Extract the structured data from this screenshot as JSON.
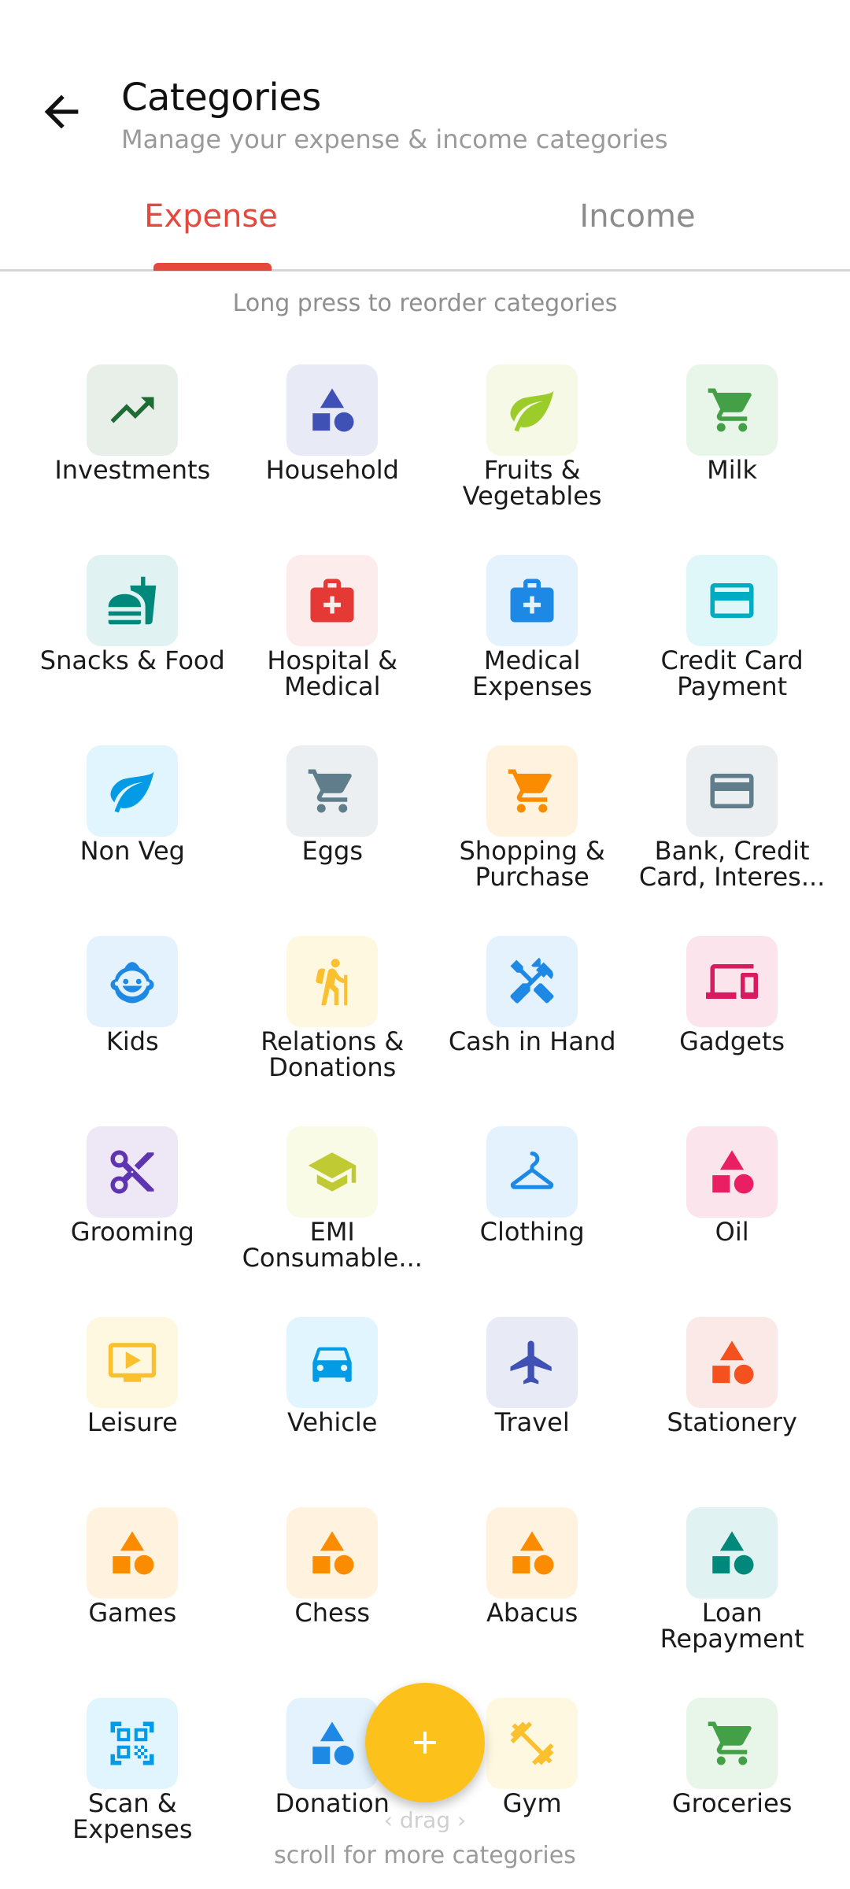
{
  "header": {
    "title": "Categories",
    "subtitle": "Manage your expense & income categories"
  },
  "tabs": [
    {
      "label": "Expense",
      "active": true
    },
    {
      "label": "Income",
      "active": false
    }
  ],
  "hint": "Long press to reorder categories",
  "categories": [
    {
      "label": "Investments",
      "icon": "trending-up-icon",
      "color": "#1e6b34",
      "bg": "#e8efe9"
    },
    {
      "label": "Household",
      "icon": "shapes-icon",
      "color": "#3f51b5",
      "bg": "#e8eaf6"
    },
    {
      "label": "Fruits & Vegetables",
      "icon": "leaf-icon",
      "color": "#9ccc2a",
      "bg": "#f5f9e6"
    },
    {
      "label": "Milk",
      "icon": "cart-icon",
      "color": "#43a047",
      "bg": "#e8f5e9"
    },
    {
      "label": "Snacks & Food",
      "icon": "fastfood-icon",
      "color": "#00897b",
      "bg": "#e0f2f1"
    },
    {
      "label": "Hospital & Medical",
      "icon": "medical-bag-icon",
      "color": "#e53935",
      "bg": "#fdecec"
    },
    {
      "label": "Medical Expenses",
      "icon": "medical-bag-icon",
      "color": "#1e88e5",
      "bg": "#e3f2fd"
    },
    {
      "label": "Credit Card Payment",
      "icon": "credit-card-icon",
      "color": "#00acc1",
      "bg": "#e0f7fa"
    },
    {
      "label": "Non Veg",
      "icon": "leaf-icon",
      "color": "#039be5",
      "bg": "#e1f5fe"
    },
    {
      "label": "Eggs",
      "icon": "cart-icon",
      "color": "#607d8b",
      "bg": "#eceff1"
    },
    {
      "label": "Shopping & Purchase",
      "icon": "cart-icon",
      "color": "#fb8c00",
      "bg": "#fff3e0"
    },
    {
      "label": "Bank, Credit Card, Interes...",
      "icon": "credit-card-icon",
      "color": "#607d8b",
      "bg": "#eceff1"
    },
    {
      "label": "Kids",
      "icon": "child-face-icon",
      "color": "#1e88e5",
      "bg": "#e3f2fd"
    },
    {
      "label": "Relations & Donations",
      "icon": "elderly-icon",
      "color": "#fbc02d",
      "bg": "#fff8e1"
    },
    {
      "label": "Cash in Hand",
      "icon": "tools-icon",
      "color": "#1e88e5",
      "bg": "#e3f2fd"
    },
    {
      "label": "Gadgets",
      "icon": "devices-icon",
      "color": "#d81b60",
      "bg": "#fce4ec"
    },
    {
      "label": "Grooming",
      "icon": "scissors-icon",
      "color": "#5e35b1",
      "bg": "#ede7f6"
    },
    {
      "label": "EMI Consumable...",
      "icon": "school-icon",
      "color": "#c0ca33",
      "bg": "#f9fbe7"
    },
    {
      "label": "Clothing",
      "icon": "hanger-icon",
      "color": "#1e88e5",
      "bg": "#e3f2fd"
    },
    {
      "label": "Oil",
      "icon": "shapes-icon",
      "color": "#e91e63",
      "bg": "#fce4ec"
    },
    {
      "label": "Leisure",
      "icon": "tv-icon",
      "color": "#fbc02d",
      "bg": "#fff8e1"
    },
    {
      "label": "Vehicle",
      "icon": "car-icon",
      "color": "#039be5",
      "bg": "#e1f5fe"
    },
    {
      "label": "Travel",
      "icon": "airplane-icon",
      "color": "#3f51b5",
      "bg": "#e8eaf6"
    },
    {
      "label": "Stationery",
      "icon": "shapes-icon",
      "color": "#f4511e",
      "bg": "#fbe9e7"
    },
    {
      "label": "Games",
      "icon": "shapes-icon",
      "color": "#fb8c00",
      "bg": "#fff3e0"
    },
    {
      "label": "Chess",
      "icon": "shapes-icon",
      "color": "#fb8c00",
      "bg": "#fff3e0"
    },
    {
      "label": "Abacus",
      "icon": "shapes-icon",
      "color": "#fb8c00",
      "bg": "#fff3e0"
    },
    {
      "label": "Loan Repayment",
      "icon": "shapes-icon",
      "color": "#00897b",
      "bg": "#e0f2f1"
    },
    {
      "label": "Scan & Expenses",
      "icon": "qr-scan-icon",
      "color": "#039be5",
      "bg": "#e1f5fe"
    },
    {
      "label": "Donation",
      "icon": "shapes-icon",
      "color": "#1e88e5",
      "bg": "#e3f2fd"
    },
    {
      "label": "Gym",
      "icon": "dumbbell-icon",
      "color": "#fbc02d",
      "bg": "#fff8e1"
    },
    {
      "label": "Groceries",
      "icon": "cart-icon",
      "color": "#43a047",
      "bg": "#e8f5e9"
    }
  ],
  "fab": {
    "icon": "plus-icon",
    "color": "#fcc21b"
  },
  "drag_hint": "drag",
  "scroll_hint": "scroll for more categories"
}
